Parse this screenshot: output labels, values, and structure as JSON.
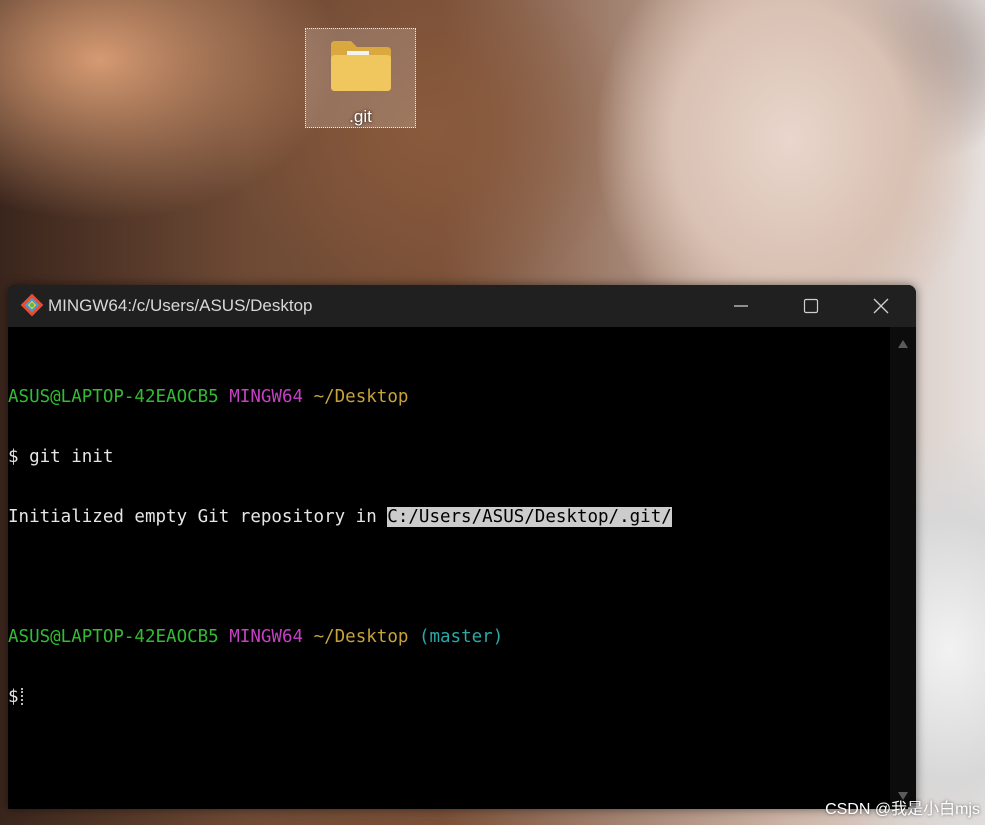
{
  "desktop": {
    "icon_label": ".git",
    "icon_name": "folder-icon"
  },
  "window": {
    "title": "MINGW64:/c/Users/ASUS/Desktop",
    "app_icon": "git-icon",
    "controls": {
      "minimize": "minimize-icon",
      "maximize": "maximize-icon",
      "close": "close-icon"
    }
  },
  "terminal": {
    "line1": {
      "user_host": "ASUS@LAPTOP-42EAOCB5",
      "env": "MINGW64",
      "path": "~/Desktop"
    },
    "line2": {
      "prompt": "$",
      "command": "git init"
    },
    "line3": {
      "text": "Initialized empty Git repository in ",
      "selected_path": "C:/Users/ASUS/Desktop/.git/"
    },
    "line5": {
      "user_host": "ASUS@LAPTOP-42EAOCB5",
      "env": "MINGW64",
      "path": "~/Desktop",
      "branch": "(master)"
    },
    "line6": {
      "prompt": "$"
    }
  },
  "watermark": "CSDN @我是小白mjs",
  "colors": {
    "user_host": "#33bb33",
    "env": "#c540c5",
    "path": "#c8a23a",
    "branch": "#2aa8a8",
    "terminal_bg": "#000000",
    "titlebar_bg": "#202020"
  }
}
